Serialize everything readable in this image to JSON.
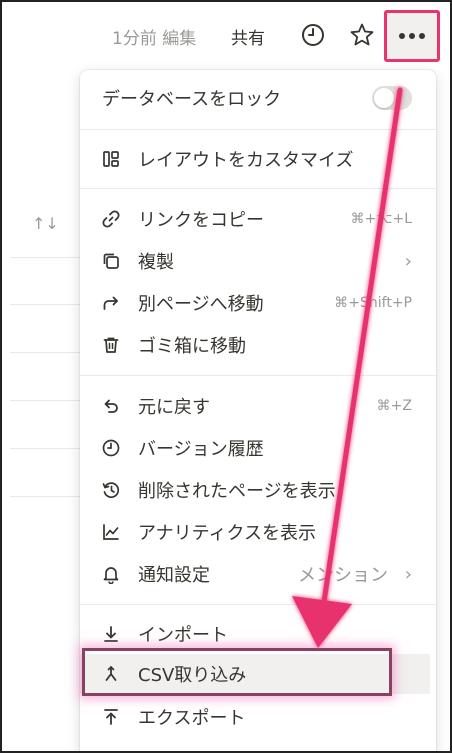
{
  "topbar": {
    "edited": "1分前 編集",
    "share": "共有",
    "icons": [
      "clock-icon",
      "star-icon",
      "more-icon"
    ]
  },
  "menu": {
    "lock_db": "データベースをロック",
    "customize_layout": "レイアウトをカスタマイズ",
    "copy_link": "リンクをコピー",
    "copy_link_shortcut": "⌘+⌥+L",
    "duplicate": "複製",
    "move_to": "別ページへ移動",
    "move_to_shortcut": "⌘+Shift+P",
    "trash": "ゴミ箱に移動",
    "undo": "元に戻す",
    "undo_shortcut": "⌘+Z",
    "version_history": "バージョン履歴",
    "show_deleted": "削除されたページを表示",
    "analytics": "アナリティクスを表示",
    "notifications": "通知設定",
    "notifications_value": "メンション",
    "import": "インポート",
    "csv_import": "CSV取り込み",
    "export": "エクスポート"
  },
  "colors": {
    "accent": "#e8336d",
    "highlight_border": "#8a4060"
  }
}
